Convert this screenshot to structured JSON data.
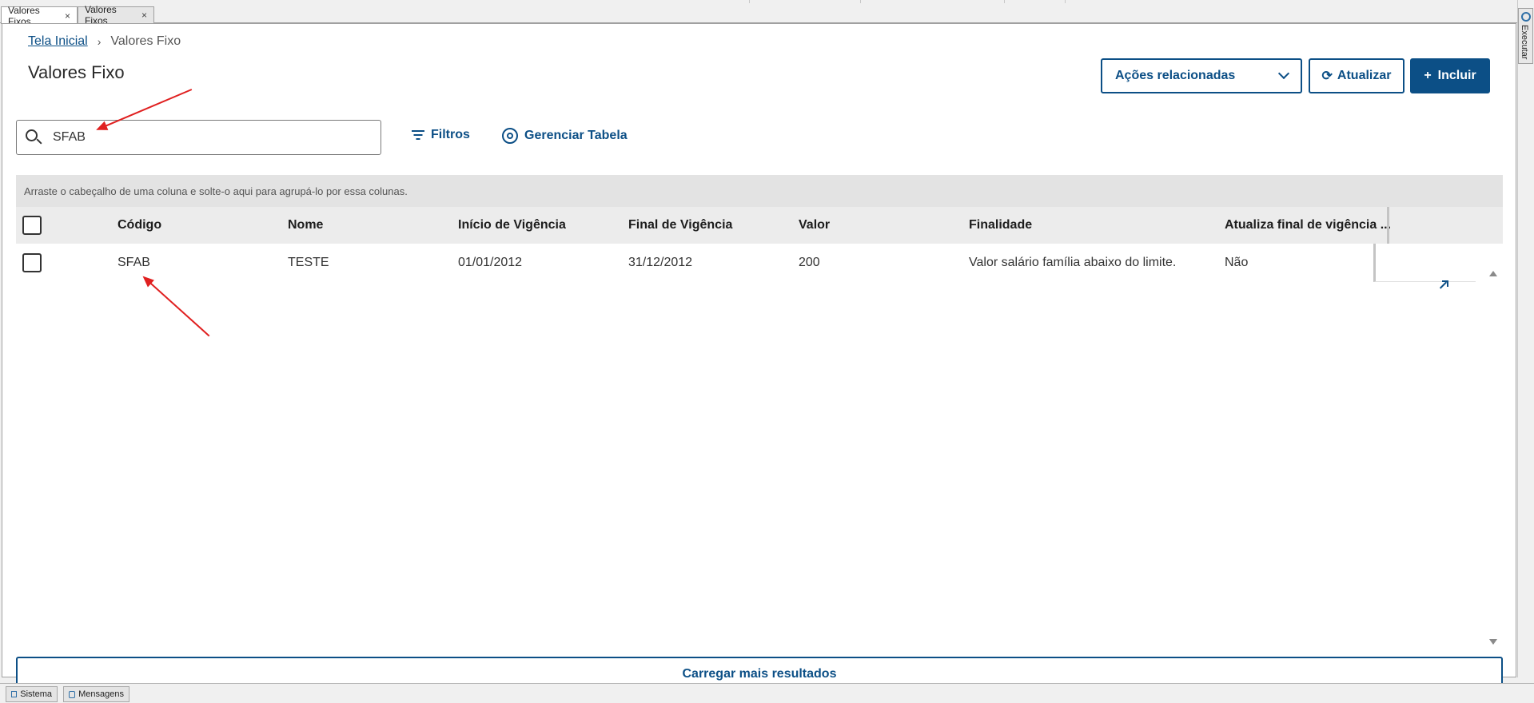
{
  "tabs": [
    {
      "label": "Valores Fixos",
      "close": "×"
    },
    {
      "label": "Valores Fixos",
      "close": "×"
    }
  ],
  "side_panel": {
    "label": "Executar",
    "icon": "gear-icon"
  },
  "breadcrumb": {
    "home": "Tela Inicial",
    "separator": "›",
    "current": "Valores Fixo"
  },
  "page_title": "Valores Fixo",
  "toolbar": {
    "actions_label": "Ações relacionadas",
    "refresh_label": "Atualizar",
    "refresh_icon": "⟳",
    "add_label": "Incluir",
    "add_icon": "+"
  },
  "search": {
    "value": "SFAB",
    "placeholder": ""
  },
  "filters_label": "Filtros",
  "manage_table_label": "Gerenciar Tabela",
  "group_hint": "Arraste o cabeçalho de uma coluna e solte-o aqui para agrupá-lo por essa colunas.",
  "table": {
    "columns": [
      "Código",
      "Nome",
      "Início de Vigência",
      "Final de Vigência",
      "Valor",
      "Finalidade",
      "Atualiza final de vigência ..."
    ],
    "rows": [
      {
        "codigo": "SFAB",
        "nome": "TESTE",
        "inicio": "01/01/2012",
        "final": "31/12/2012",
        "valor": "200",
        "finalidade": "Valor salário família abaixo do limite.",
        "atualiza": "Não"
      }
    ]
  },
  "load_more_label": "Carregar mais resultados",
  "statusbar": {
    "sistema": "Sistema",
    "mensagens": "Mensagens"
  },
  "colors": {
    "primary": "#0c4f86",
    "annotation": "#e02020"
  }
}
